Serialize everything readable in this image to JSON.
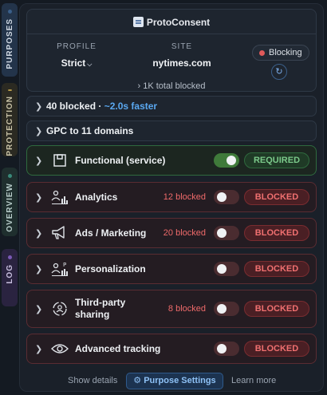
{
  "side_tabs": {
    "purposes": {
      "label": "PURPOSES",
      "dot": "#3a5f8a"
    },
    "protection": {
      "label": "PROTECTION",
      "dot": "#b59a4a"
    },
    "overview": {
      "label": "OVERVIEW",
      "dot": "#3a8a7a"
    },
    "log": {
      "label": "LOG",
      "dot": "#7a5ab5"
    }
  },
  "header": {
    "brand": "ProtoConsent",
    "profile_caption": "PROFILE",
    "profile_value": "Strict",
    "site_caption": "SITE",
    "site_value": "nytimes.com",
    "status": "Blocking",
    "total_blocked": "1K total blocked"
  },
  "summary": {
    "blocked": "40 blocked · ",
    "faster": "~2.0s faster",
    "gpc": "GPC to 11 domains"
  },
  "categories": [
    {
      "name": "Functional (service)",
      "count": "",
      "toggle": "on",
      "badge": "REQUIRED"
    },
    {
      "name": "Analytics",
      "count": "12 blocked",
      "toggle": "off",
      "badge": "BLOCKED"
    },
    {
      "name": "Ads / Marketing",
      "count": "20 blocked",
      "toggle": "off",
      "badge": "BLOCKED"
    },
    {
      "name": "Personalization",
      "count": "",
      "toggle": "off",
      "badge": "BLOCKED"
    },
    {
      "name_line1": "Third-party",
      "name_line2": "sharing",
      "count": "8 blocked",
      "toggle": "off",
      "badge": "BLOCKED"
    },
    {
      "name": "Advanced tracking",
      "count": "",
      "toggle": "off",
      "badge": "BLOCKED"
    }
  ],
  "footer": {
    "show_details": "Show details",
    "settings": "Purpose Settings",
    "learn_more": "Learn more"
  },
  "icons": {
    "functional": "box-icon",
    "analytics": "people-chart-icon",
    "ads": "megaphone-icon",
    "personalization": "person-chart-icon",
    "third_party": "shared-user-icon",
    "advanced": "eye-icon"
  },
  "colors": {
    "blocked": "#f07070",
    "required": "#7bc98a",
    "accent": "#5aa8f0"
  }
}
